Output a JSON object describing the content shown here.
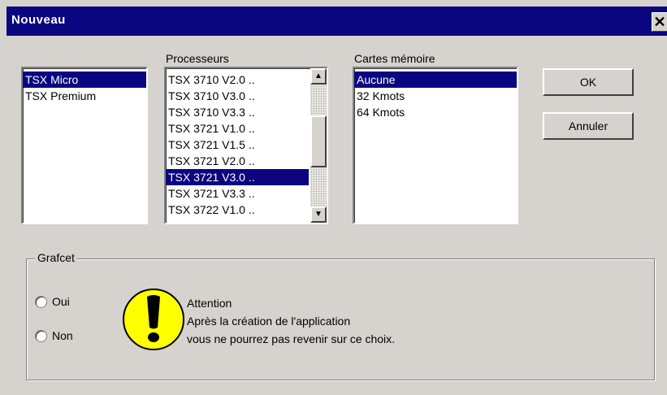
{
  "window": {
    "title": "Nouveau",
    "close_glyph": "✕"
  },
  "type_list": {
    "items": [
      "TSX Micro",
      "TSX Premium"
    ],
    "selected_index": 0
  },
  "processor_list": {
    "label": "Processeurs",
    "items": [
      "TSX 3710  V2.0  ..",
      "TSX 3710  V3.0  ..",
      "TSX 3710  V3.3  ..",
      "TSX 3721  V1.0  ..",
      "TSX 3721  V1.5  ..",
      "TSX 3721  V2.0  ..",
      "TSX 3721  V3.0  ..",
      "TSX 3721  V3.3  ..",
      "TSX 3722  V1.0  .."
    ],
    "selected_index": 6
  },
  "memory_list": {
    "label": "Cartes mémoire",
    "items": [
      "Aucune",
      "32 Kmots",
      "64 Kmots"
    ],
    "selected_index": 0
  },
  "buttons": {
    "ok": "OK",
    "cancel": "Annuler"
  },
  "grafcet": {
    "title": "Grafcet",
    "options": [
      "Oui",
      "Non"
    ],
    "message": [
      "Attention",
      "Après la création de l'application",
      "vous ne pourrez pas revenir sur ce choix."
    ]
  },
  "icons": {
    "warning": "warning-icon",
    "scroll_up": "▲",
    "scroll_down": "▼"
  }
}
